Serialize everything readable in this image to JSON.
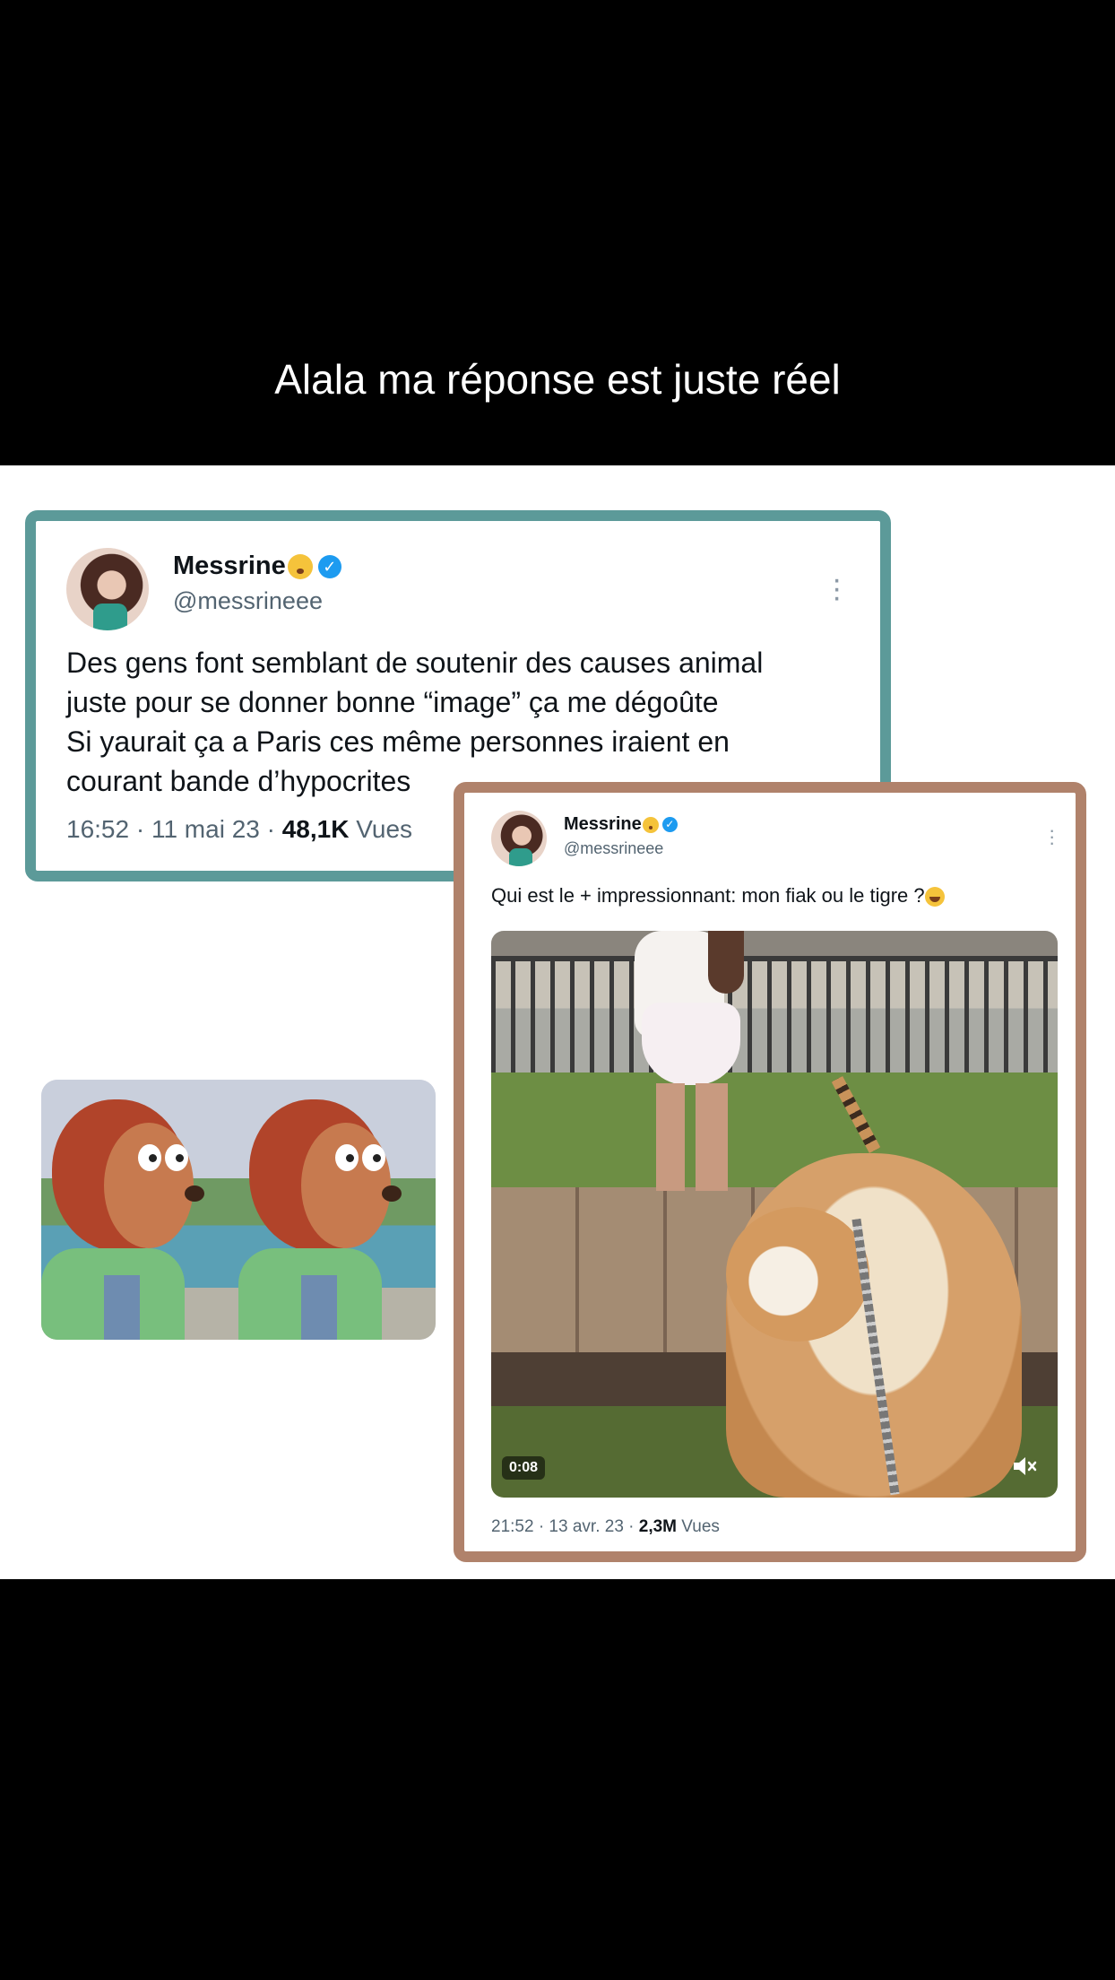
{
  "caption": "Alala ma réponse est juste réel",
  "tweet1": {
    "name": "Messrine",
    "handle": "@messrineee",
    "lines": [
      "Des gens font semblant de soutenir des causes animal",
      "juste pour se donner bonne “image” ça me dégoûte",
      "Si yaurait ça a Paris ces même personnes iraient en",
      "courant bande d’hypocrites"
    ],
    "time": "16:52 · 11 mai 23 · ",
    "views_count": "48,1K",
    "views_label": " Vues",
    "border_color": "#5c9a99"
  },
  "tweet2": {
    "name": "Messrine",
    "handle": "@messrineee",
    "text": "Qui est le + impressionnant: mon fiak ou le tigre ?",
    "video_time": "0:08",
    "time": "21:52 · 13 avr. 23 · ",
    "views_count": "2,3M",
    "views_label": " Vues",
    "border_color": "#b0826b"
  },
  "icons": [
    "verified-badge-icon",
    "shushing-face-emoji-icon",
    "more-options-icon",
    "laughing-emoji-icon",
    "mute-icon"
  ]
}
